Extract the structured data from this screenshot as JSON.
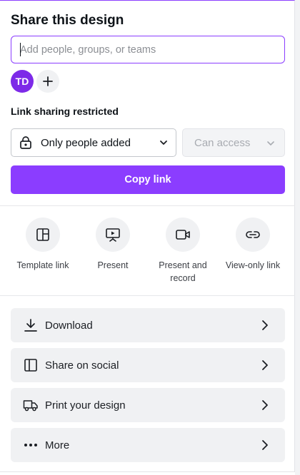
{
  "header": {
    "title": "Share this design"
  },
  "search": {
    "placeholder": "Add people, groups, or teams",
    "value": ""
  },
  "collaborators": [
    {
      "initials": "TD",
      "color": "#7d2ae8"
    }
  ],
  "link_sharing": {
    "label": "Link sharing restricted",
    "access_value": "Only people added",
    "permission_value": "Can access",
    "copy_label": "Copy link"
  },
  "quick_actions": [
    {
      "label": "Template link",
      "icon": "template-icon"
    },
    {
      "label": "Present",
      "icon": "present-icon"
    },
    {
      "label": "Present and record",
      "icon": "video-camera-icon"
    },
    {
      "label": "View-only link",
      "icon": "link-icon"
    }
  ],
  "actions": [
    {
      "label": "Download",
      "icon": "download-icon"
    },
    {
      "label": "Share on social",
      "icon": "social-layout-icon"
    },
    {
      "label": "Print your design",
      "icon": "truck-icon"
    },
    {
      "label": "More",
      "icon": "more-dots-icon"
    }
  ],
  "colors": {
    "accent": "#8b3dff",
    "avatar": "#7d2ae8"
  }
}
